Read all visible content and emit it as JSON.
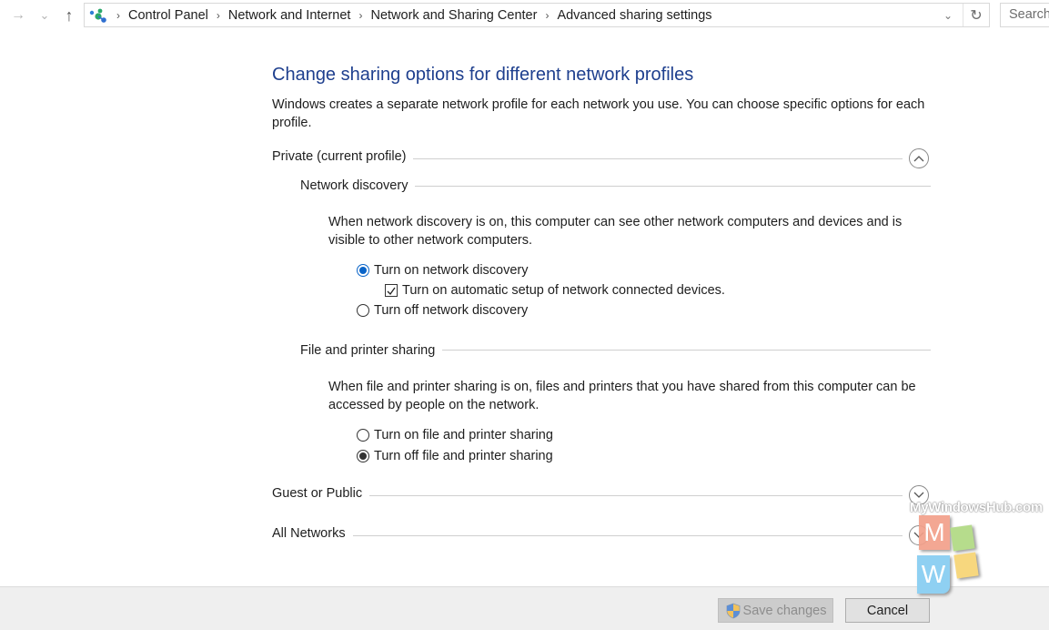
{
  "nav": {
    "back_icon": "arrow-left-icon",
    "forward_icon": "arrow-right-icon",
    "recent_icon": "chevron-down-icon",
    "up_icon": "arrow-up-icon",
    "back_glyph": "→",
    "recent_glyph": "⌄",
    "up_glyph": "↑",
    "breadcrumbs": [
      "Control Panel",
      "Network and Internet",
      "Network and Sharing Center",
      "Advanced sharing settings"
    ],
    "separator": "›",
    "dropdown_glyph": "⌄",
    "refresh_glyph": "↻",
    "search_placeholder": "Search"
  },
  "content": {
    "title": "Change sharing options for different network profiles",
    "intro": "Windows creates a separate network profile for each network you use. You can choose specific options for each profile.",
    "profiles": [
      {
        "label": "Private (current profile)",
        "expanded": true,
        "sections": [
          {
            "label": "Network discovery",
            "description": "When network discovery is on, this computer can see other network computers and devices and is visible to other network computers.",
            "options": [
              {
                "type": "radio",
                "label": "Turn on network discovery",
                "checked": true
              },
              {
                "type": "checkbox",
                "label": "Turn on automatic setup of network connected devices.",
                "checked": true
              },
              {
                "type": "radio",
                "label": "Turn off network discovery",
                "checked": false
              }
            ]
          },
          {
            "label": "File and printer sharing",
            "description": "When file and printer sharing is on, files and printers that you have shared from this computer can be accessed by people on the network.",
            "options": [
              {
                "type": "radio",
                "label": "Turn on file and printer sharing",
                "checked": false
              },
              {
                "type": "radio",
                "label": "Turn off file and printer sharing",
                "checked": true
              }
            ]
          }
        ]
      },
      {
        "label": "Guest or Public",
        "expanded": false
      },
      {
        "label": "All Networks",
        "expanded": false
      }
    ]
  },
  "footer": {
    "save_label": "Save changes",
    "save_enabled": false,
    "cancel_label": "Cancel"
  },
  "watermark": {
    "text": "MyWindowsHub.com",
    "letters": [
      "M",
      "W"
    ]
  },
  "colors": {
    "title": "#1e3f8e",
    "radio_selected": "#0a64c8",
    "footer_bg": "#efefef"
  }
}
